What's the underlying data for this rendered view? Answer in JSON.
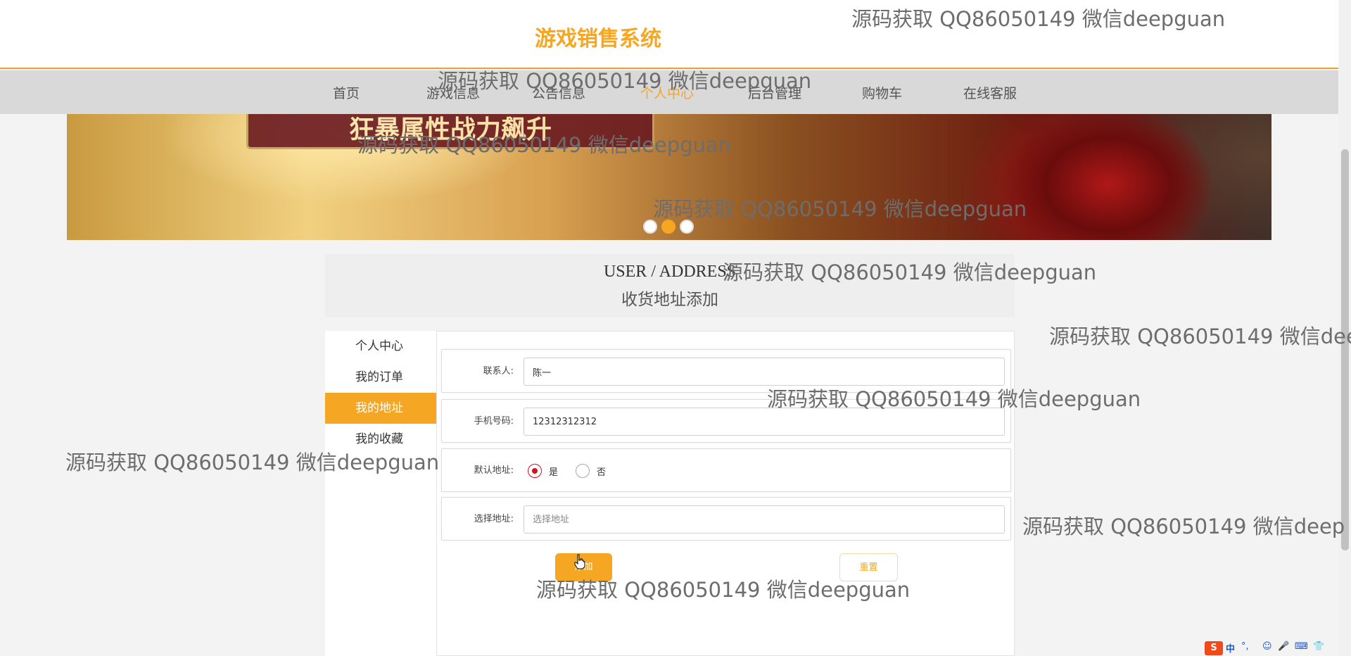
{
  "header": {
    "title": "游戏销售系统"
  },
  "nav": {
    "items": [
      {
        "label": "首页",
        "active": false
      },
      {
        "label": "游戏信息",
        "active": false
      },
      {
        "label": "公告信息",
        "active": false
      },
      {
        "label": "个人中心",
        "active": true
      },
      {
        "label": "后台管理",
        "active": false
      },
      {
        "label": "购物车",
        "active": false
      },
      {
        "label": "在线客服",
        "active": false
      }
    ]
  },
  "banner": {
    "sign_text": "狂暴属性战力飙升",
    "active_dot": 2,
    "dot_count": 3
  },
  "section": {
    "title_en": "USER / ADDRESS",
    "title_zh": "收货地址添加"
  },
  "sidebar": {
    "items": [
      {
        "label": "个人中心",
        "active": false
      },
      {
        "label": "我的订单",
        "active": false
      },
      {
        "label": "我的地址",
        "active": true
      },
      {
        "label": "我的收藏",
        "active": false
      }
    ]
  },
  "form": {
    "contact": {
      "label": "联系人:",
      "value": "陈一"
    },
    "phone": {
      "label": "手机号码:",
      "value": "12312312312"
    },
    "default": {
      "label": "默认地址:",
      "options": [
        "是",
        "否"
      ],
      "selected": "是"
    },
    "address": {
      "label": "选择地址:",
      "value": "",
      "placeholder": "选择地址"
    },
    "submit_label": "添加",
    "reset_label": "重置"
  },
  "tray": {
    "ime_badge": "S",
    "ime_mode": "中",
    "punct": "°,",
    "icons": [
      "☺",
      "🎤",
      "⌨",
      "👕"
    ]
  },
  "watermark": {
    "text": "源码获取 QQ86050149 微信deepguan",
    "clipped_text": "源码获取 QQ86050149 微信dee",
    "clipped_text_2": "源码获取 QQ86050149 微信deep"
  },
  "colors": {
    "accent": "#f5a623",
    "nav_bg": "#d9d9d9",
    "radio_checked": "#d0161d"
  }
}
